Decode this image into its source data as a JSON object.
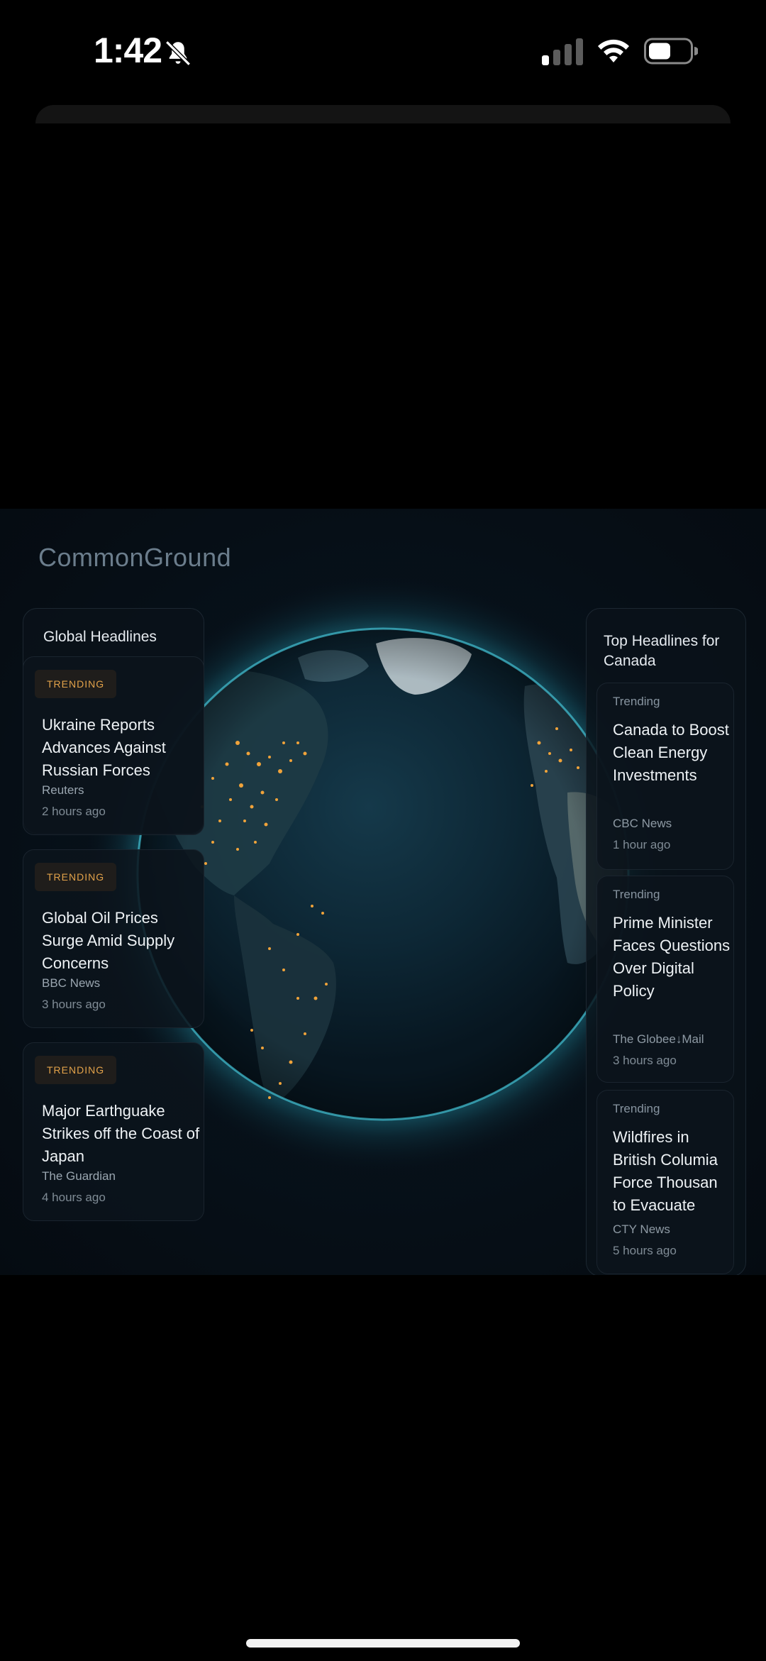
{
  "status_bar": {
    "time": "1:42"
  },
  "app": {
    "brand": "CommonGround"
  },
  "global_panel": {
    "title": "Global Headlines",
    "items": [
      {
        "badge": "TRENDING",
        "title": "Ukraine Reports Advances Against Russian Forces",
        "source": "Reuters",
        "age": "2 hours ago"
      },
      {
        "badge": "TRENDING",
        "title": "Global Oil Prices Surge Amid Supply Concerns",
        "source": "BBC News",
        "age": "3 hours ago"
      },
      {
        "badge": "TRENDING",
        "title": "Major Earthguake Strikes off the Coast of Japan",
        "source": "The Guardian",
        "age": "4 hours ago"
      }
    ]
  },
  "canada_panel": {
    "title": "Top Headlines for Canada",
    "items": [
      {
        "tag": "Trending",
        "title": "Canada to Boost Clean Energy Investments",
        "source": "CBC News",
        "age": "1 hour ago"
      },
      {
        "tag": "Trending",
        "title": "Prime Minister Faces Questions Over Digital Policy",
        "source": "The Globee↓Mail",
        "age": "3 hours ago"
      },
      {
        "tag": "Trending",
        "title": "Wildfires in British Columia Force Thousan to Evacuate",
        "source": "CTY News",
        "age": "5 hours ago"
      }
    ]
  },
  "colors": {
    "accent": "#e2a24a",
    "globe_rim": "#3fb6c8",
    "city_lights": "#f0a33a"
  }
}
